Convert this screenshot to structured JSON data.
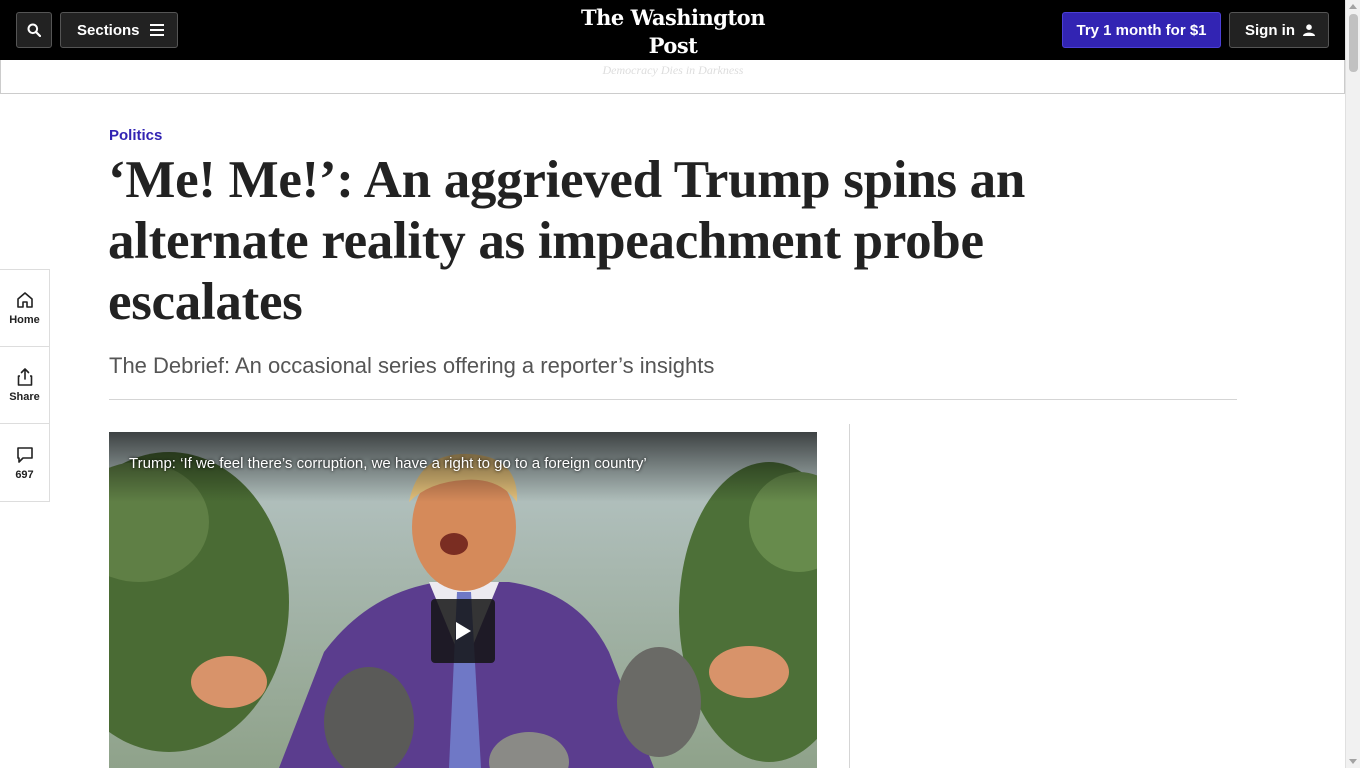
{
  "nav": {
    "sections_label": "Sections",
    "logo": "The Washington Post",
    "tagline": "Democracy Dies in Darkness",
    "try_label": "Try 1 month for $1",
    "signin_label": "Sign in"
  },
  "rail": {
    "home_label": "Home",
    "share_label": "Share",
    "comments_count": "697"
  },
  "article": {
    "kicker": "Politics",
    "headline": "‘Me! Me!’: An aggrieved Trump spins an alternate reality as impeachment probe escalates",
    "dek": "The Debrief: An occasional series offering a reporter’s insights"
  },
  "video": {
    "caption": "Trump: ‘If we feel there’s corruption, we have a right to go to a foreign country’"
  },
  "colors": {
    "accent": "#3224b3",
    "nav_bg": "#000000"
  }
}
